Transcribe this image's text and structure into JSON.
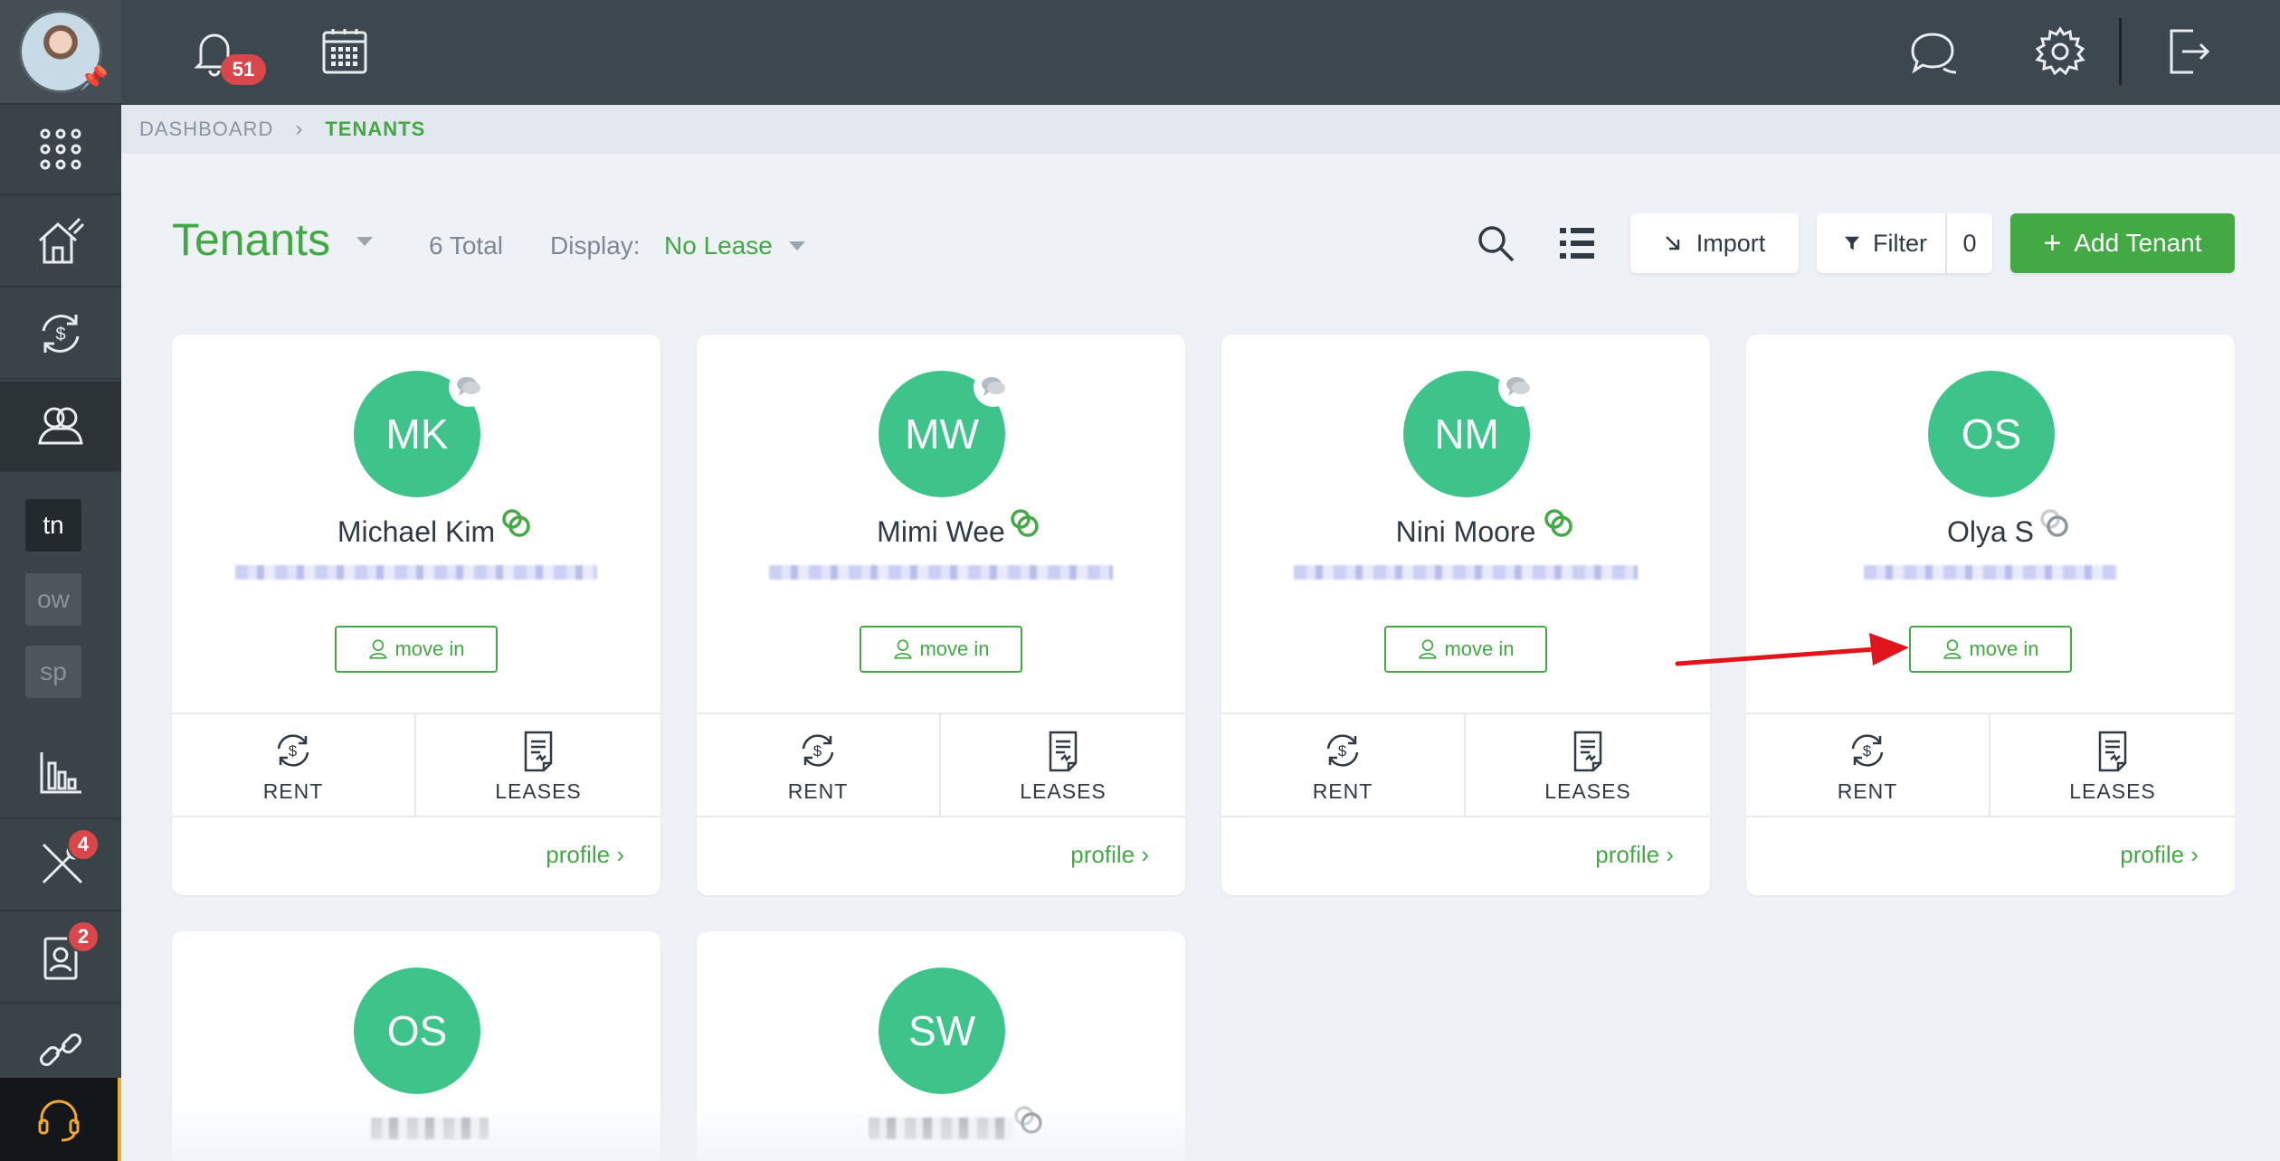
{
  "sidebar": {
    "items": [
      {
        "name": "apps-icon",
        "label": ""
      },
      {
        "name": "properties-icon",
        "label": ""
      },
      {
        "name": "accounting-icon",
        "label": ""
      },
      {
        "name": "tenants-icon",
        "label": ""
      },
      {
        "name": "reports-icon",
        "label": ""
      },
      {
        "name": "maintenance-icon",
        "label": "",
        "badge": "4"
      },
      {
        "name": "applicants-icon",
        "label": "",
        "badge": "2"
      },
      {
        "name": "integrations-icon",
        "label": ""
      }
    ],
    "shortcuts": [
      "tn",
      "ow",
      "sp"
    ],
    "maintenance_badge": "4",
    "applicants_badge": "2"
  },
  "topbar": {
    "notification_count": "51"
  },
  "breadcrumb": {
    "home": "DASHBOARD",
    "current": "TENANTS"
  },
  "header": {
    "title": "Tenants",
    "total": "6 Total",
    "display_label": "Display:",
    "display_value": "No Lease",
    "import_label": "Import",
    "filter_label": "Filter",
    "filter_count": "0",
    "add_label": "Add Tenant"
  },
  "colors": {
    "accent": "#43a944",
    "avatar": "#3ec48b",
    "topbar": "#3c4750",
    "sidebar": "#394348",
    "badge": "#d9474b",
    "arrow": "#e0141b"
  },
  "tenants": [
    {
      "initials": "MK",
      "name": "Michael Kim",
      "move_in": "move in",
      "rent": "RENT",
      "leases": "LEASES",
      "profile": "profile"
    },
    {
      "initials": "MW",
      "name": "Mimi Wee",
      "move_in": "move in",
      "rent": "RENT",
      "leases": "LEASES",
      "profile": "profile"
    },
    {
      "initials": "NM",
      "name": "Nini Moore",
      "move_in": "move in",
      "rent": "RENT",
      "leases": "LEASES",
      "profile": "profile"
    },
    {
      "initials": "OS",
      "name": "Olya S",
      "move_in": "move in",
      "rent": "RENT",
      "leases": "LEASES",
      "profile": "profile"
    },
    {
      "initials": "OS",
      "name": ""
    },
    {
      "initials": "SW",
      "name": ""
    }
  ]
}
